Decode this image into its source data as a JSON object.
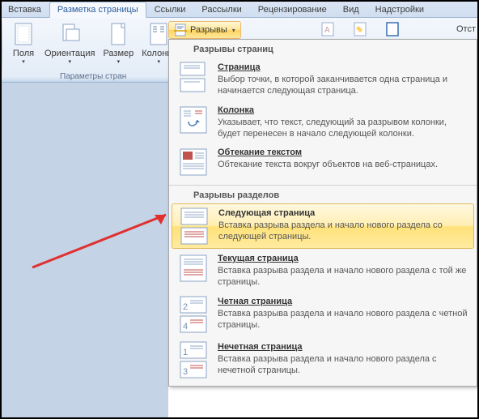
{
  "tabs": {
    "insert": "Вставка",
    "page_layout": "Разметка страницы",
    "links": "Ссылки",
    "mailings": "Рассылки",
    "review": "Рецензирование",
    "view": "Вид",
    "addins": "Надстройки"
  },
  "ribbon": {
    "margins": "Поля",
    "orientation": "Ориентация",
    "size": "Размер",
    "columns": "Колонки",
    "group_label": "Параметры стран",
    "breaks": "Разрывы",
    "indent_label": "Отст"
  },
  "dropdown": {
    "section1_header": "Разрывы страниц",
    "page": {
      "title": "Страница",
      "desc": "Выбор точки, в которой заканчивается одна страница и начинается следующая страница."
    },
    "column": {
      "title": "Колонка",
      "desc": "Указывает, что текст, следующий за разрывом колонки, будет перенесен в начало следующей колонки."
    },
    "wrap": {
      "title": "Обтекание текстом",
      "desc": "Обтекание текста вокруг объектов на веб-страницах."
    },
    "section2_header": "Разрывы разделов",
    "next_page": {
      "title": "Следующая страница",
      "desc": "Вставка разрыва раздела и начало нового раздела со следующей страницы."
    },
    "current_page": {
      "title": "Текущая страница",
      "desc": "Вставка разрыва раздела и начало нового раздела с той же страницы."
    },
    "even_page": {
      "title": "Четная страница",
      "desc": "Вставка разрыва раздела и начало нового раздела с четной страницы."
    },
    "odd_page": {
      "title": "Нечетная страница",
      "desc": "Вставка разрыва раздела и начало нового раздела с нечетной страницы."
    }
  }
}
